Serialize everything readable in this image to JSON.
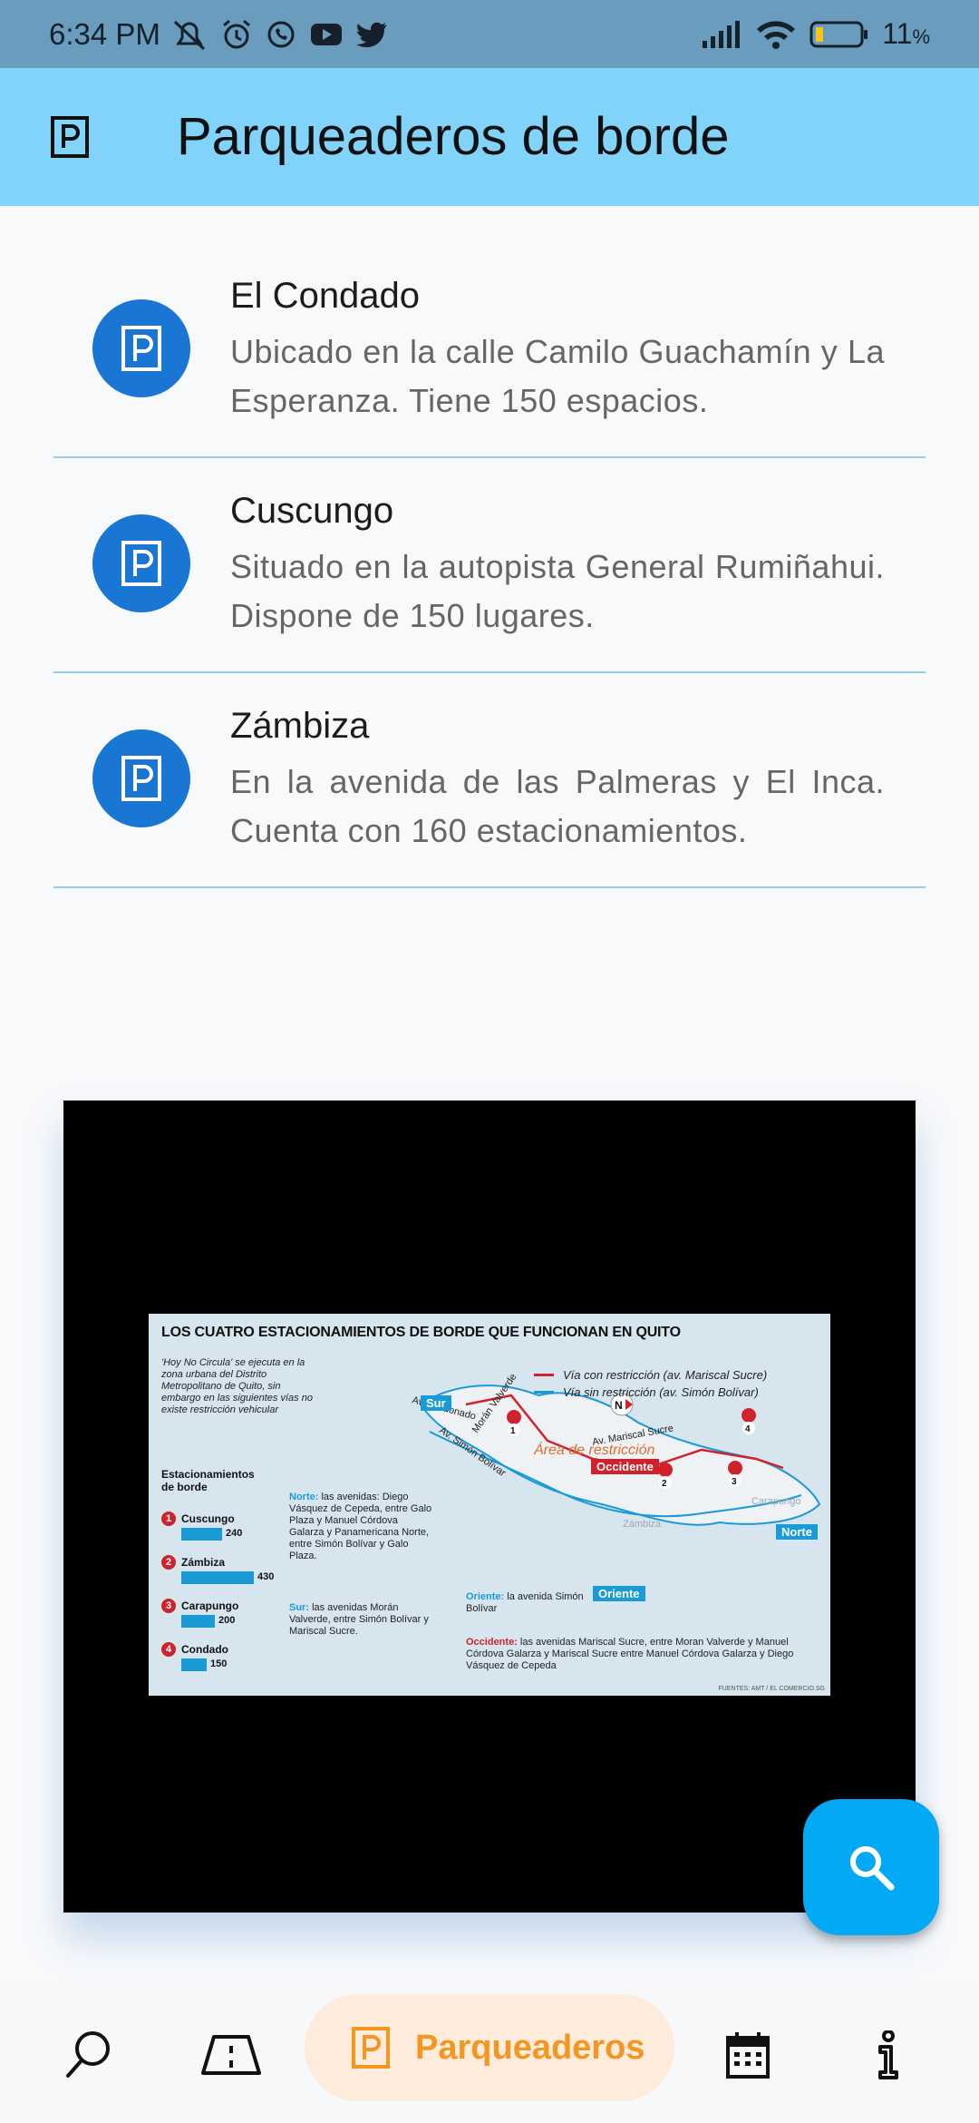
{
  "status_bar": {
    "time": "6:34 PM",
    "battery_percent": "11",
    "battery_unit": "%",
    "icons": [
      "mute-icon",
      "alarm-icon",
      "whatsapp-icon",
      "youtube-icon",
      "twitter-icon",
      "signal-icon",
      "wifi-icon",
      "battery-icon"
    ]
  },
  "app_bar": {
    "title": "Parqueaderos de borde",
    "icon": "parking-icon"
  },
  "parkings": [
    {
      "name": "El Condado",
      "description": "Ubicado en la calle Camilo Guachamín y La Esperanza. Tiene 150 espacios."
    },
    {
      "name": "Cuscungo",
      "description": "Situado en la autopista General Rumiñahui. Dispone de 150 lugares."
    },
    {
      "name": "Zámbiza",
      "description": "En la avenida de las Palmeras y El Inca. Cuenta con 160 estacionamientos."
    }
  ],
  "infographic": {
    "title": "LOS CUATRO ESTACIONAMIENTOS DE BORDE QUE FUNCIONAN EN QUITO",
    "note": "'Hoy No Circula' se ejecuta en la zona urbana del Distrito Metropolitano de Quito, sin embargo en las siguientes vías no existe restricción vehicular",
    "parking_heading": "Estacionamientos de borde",
    "bars": [
      {
        "num": "1",
        "name": "Cuscungo",
        "value": 240
      },
      {
        "num": "2",
        "name": "Zámbiza",
        "value": 430
      },
      {
        "num": "3",
        "name": "Carapungo",
        "value": 200
      },
      {
        "num": "4",
        "name": "Condado",
        "value": 150
      }
    ],
    "legend": {
      "restricted": "Vía con restricción (av. Mariscal Sucre)",
      "unrestricted": "Vía sin restricción (av. Simón Bolívar)"
    },
    "tags": {
      "sur": "Sur",
      "occidente": "Occidente",
      "norte": "Norte",
      "oriente": "Oriente"
    },
    "map_labels": {
      "av_maldonado": "Av. Maldonado",
      "moran_valverde": "Morán Valverde",
      "av_simon_bolivar": "Av. Simón Bolívar",
      "av_mariscal_sucre": "Av. Mariscal Sucre",
      "area": "Área de restricción",
      "carapungo": "Carapungo",
      "zambiza": "Zámbiza",
      "north": "N"
    },
    "texts": {
      "norte_label": "Norte:",
      "norte": "las avenidas: Diego Vásquez de Cepeda, entre Galo Plaza y Manuel Córdova Galarza y Panamericana Norte, entre Simón Bolívar y Galo Plaza.",
      "sur_label": "Sur:",
      "sur": "las avenidas Morán Valverde, entre Simón Bolívar y Mariscal Sucre.",
      "oriente_label": "Oriente:",
      "oriente": "la avenida Simón Bolívar",
      "occidente_label": "Occidente:",
      "occidente": "las avenidas Mariscal Sucre, entre Moran Valverde y Manuel Córdova Galarza y Mariscal Sucre entre Manuel Córdova Galarza y Diego Vásquez de Cepeda"
    },
    "source": "FUENTES: AMT / EL COMERCIO.SG"
  },
  "colors": {
    "app_bar": "#82d3f9",
    "status_bar": "#6a9cbd",
    "avatar": "#1976d2",
    "fab": "#03a9f4",
    "active_nav_bg": "#fdebdc",
    "active_nav_fg": "#f29722",
    "divider": "#9ccbe8"
  },
  "bottom_nav": {
    "items": [
      {
        "icon": "search-icon"
      },
      {
        "icon": "road-icon"
      },
      {
        "icon": "parking-icon",
        "label": "Parqueaderos",
        "active": true
      },
      {
        "icon": "calendar-icon"
      },
      {
        "icon": "info-icon"
      }
    ],
    "active_label": "Parqueaderos"
  },
  "fab": {
    "icon": "search-icon"
  }
}
